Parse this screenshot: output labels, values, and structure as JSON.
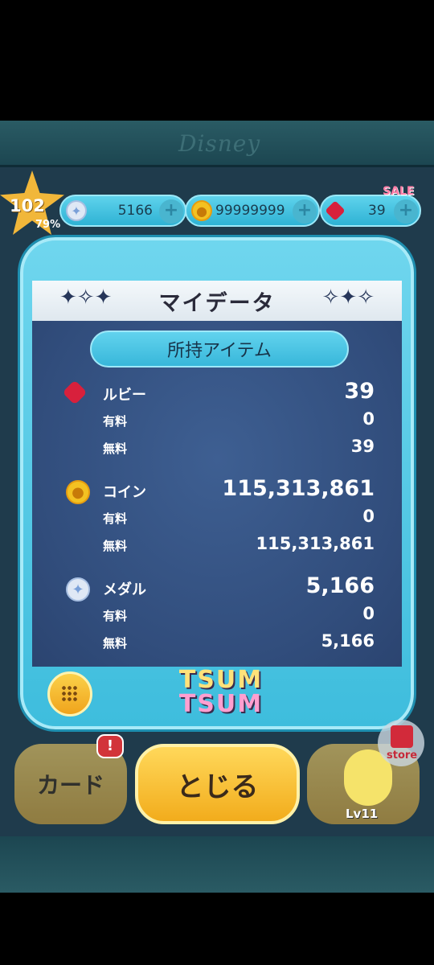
{
  "brand": {
    "logo_text": "Disney"
  },
  "status_bar": {
    "level": "102",
    "level_progress": "79%",
    "level_progress_value": 0.79,
    "medal_count": "5166",
    "coin_count": "99999999",
    "ruby_count": "39",
    "sale_badge": "SALE"
  },
  "modal": {
    "title": "マイデータ",
    "section_title": "所持アイテム",
    "ruby": {
      "label": "ルビー",
      "total": "39",
      "paid_label": "有料",
      "paid": "0",
      "free_label": "無料",
      "free": "39"
    },
    "coin": {
      "label": "コイン",
      "total": "115,313,861",
      "paid_label": "有料",
      "paid": "0",
      "free_label": "無料",
      "free": "115,313,861"
    },
    "medal": {
      "label": "メダル",
      "total": "5,166",
      "paid_label": "有料",
      "paid": "0",
      "free_label": "無料",
      "free": "5,166"
    },
    "logo_line1": "TSUM",
    "logo_line2": "TSUM"
  },
  "bottom": {
    "card_label": "カード",
    "notice_badge": "!",
    "close_label": "とじる",
    "tsum_level": "Lv11",
    "store_label": "store"
  },
  "colors": {
    "accent": "#3ebddd",
    "panel": "#314d7c",
    "button_yellow": "#f2ac1c",
    "ruby": "#d8203c",
    "coin": "#f3c122"
  }
}
